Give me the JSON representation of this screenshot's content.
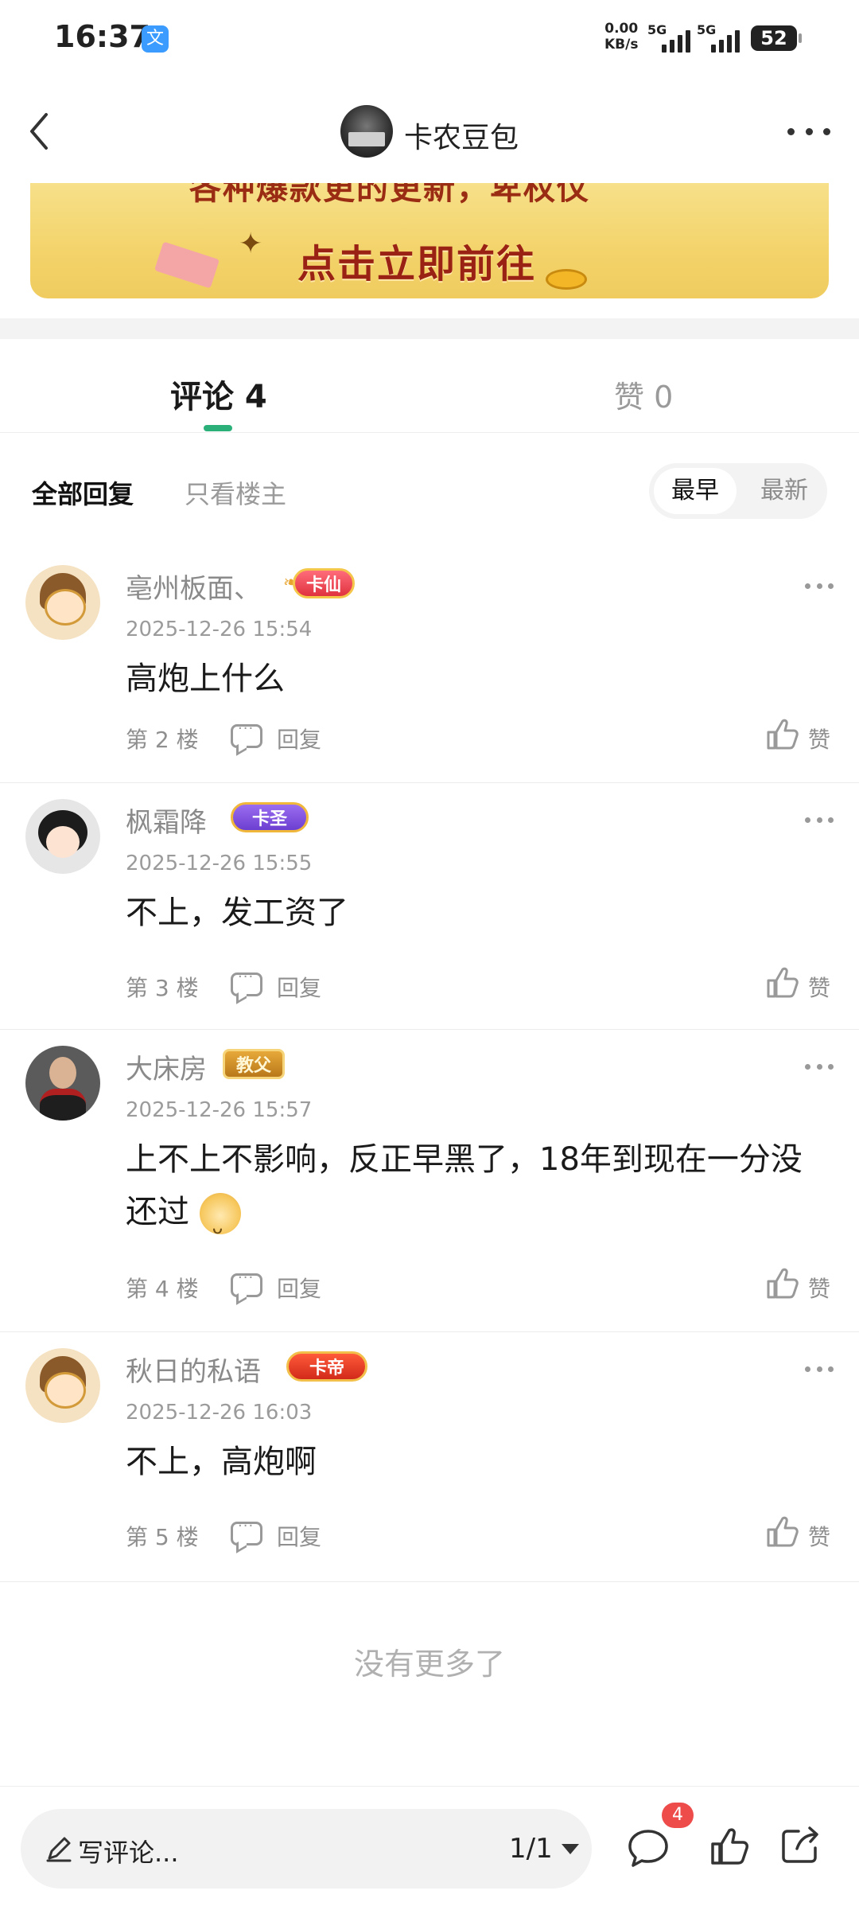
{
  "status_bar": {
    "time": "16:37",
    "app_icon": "translate-icon",
    "net_speed_value": "0.00",
    "net_speed_unit": "KB/s",
    "signal1_label": "5G",
    "signal2_label": "5G",
    "battery": "52"
  },
  "header": {
    "title": "卡农豆包",
    "back_icon": "chevron-left-icon",
    "more_icon": "more-horizontal-icon"
  },
  "banner": {
    "top_text": "各种爆款更的更新，卑权仪",
    "cta": "点击立即前往",
    "color_bg": "#f3d36a"
  },
  "tabs": {
    "comments_label": "评论 4",
    "likes_label": "赞 0",
    "accent_color": "#2bb07a"
  },
  "filters": {
    "all": "全部回复",
    "op_only": "只看楼主",
    "sort_earliest": "最早",
    "sort_latest": "最新"
  },
  "comments": [
    {
      "user": "亳州板面、",
      "badge": "卡仙",
      "time": "2025-12-26 15:54",
      "text": "高炮上什么",
      "floor": "第 2 楼",
      "reply": "回复",
      "like": "赞"
    },
    {
      "user": "枫霜降",
      "badge": "卡圣",
      "time": "2025-12-26 15:55",
      "text": "不上，发工资了",
      "floor": "第 3 楼",
      "reply": "回复",
      "like": "赞"
    },
    {
      "user": "大床房",
      "badge": "教父",
      "time": "2025-12-26 15:57",
      "text": "上不上不影响，反正早黑了，18年到现在一分没还过",
      "floor": "第 4 楼",
      "reply": "回复",
      "like": "赞"
    },
    {
      "user": "秋日的私语",
      "badge": "卡帝",
      "time": "2025-12-26 16:03",
      "text": "不上，高炮啊",
      "floor": "第 5 楼",
      "reply": "回复",
      "like": "赞"
    }
  ],
  "footer_note": "没有更多了",
  "bottom_bar": {
    "write_placeholder": "写评论...",
    "pager": "1/1",
    "comment_count": "4"
  }
}
